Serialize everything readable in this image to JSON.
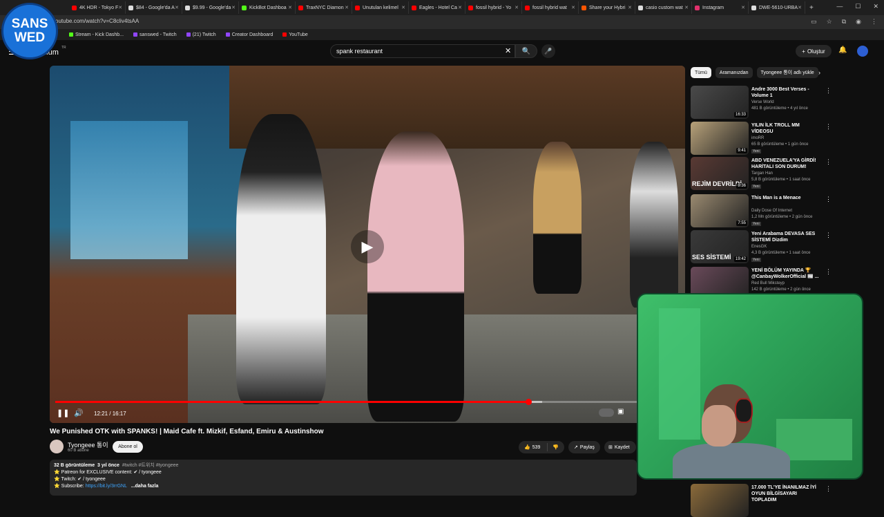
{
  "browser": {
    "tabs": [
      {
        "label": "4K HDR - Tokyo F",
        "color": "#ff0000"
      },
      {
        "label": "$84 - Google'da A",
        "color": "#dddddd"
      },
      {
        "label": "$9.99 - Google'da",
        "color": "#dddddd"
      },
      {
        "label": "KickBot Dashboa",
        "color": "#53fc18"
      },
      {
        "label": "TraxNYC Diamon",
        "color": "#ff0000"
      },
      {
        "label": "Unutulan kelimel",
        "color": "#ff0000"
      },
      {
        "label": "Eagles - Hotel Ca",
        "color": "#ff0000"
      },
      {
        "label": "fossil hybrid - Yo",
        "color": "#ff0000"
      },
      {
        "label": "fossil hybrid wat",
        "color": "#ff0000"
      },
      {
        "label": "Share your Hybri",
        "color": "#ff5500"
      },
      {
        "label": "casio custom wat",
        "color": "#dddddd"
      },
      {
        "label": "Instagram",
        "color": "#e1306c"
      },
      {
        "label": "DWE-5610-URBA",
        "color": "#dddddd"
      }
    ],
    "url": "outube.com/watch?v=C8cliv4tsAA",
    "bookmarks": [
      {
        "label": "Stream - Kick Dashb...",
        "color": "#53fc18"
      },
      {
        "label": "sanswed - Twitch",
        "color": "#9146ff"
      },
      {
        "label": "(21) Twitch",
        "color": "#9146ff"
      },
      {
        "label": "Creator Dashboard",
        "color": "#9146ff"
      },
      {
        "label": "YouTube",
        "color": "#ff0000"
      }
    ]
  },
  "overlay_logo": {
    "line1": "SANS",
    "line2": "WED"
  },
  "header": {
    "brand": "mium",
    "tm": "TR",
    "search_value": "spank restaurant",
    "create_label": "Oluştur"
  },
  "video": {
    "current_time": "12:21",
    "duration": "16:17",
    "time_display": "12:21 / 16:17",
    "progress_fraction": 0.758,
    "loaded_fraction": 0.78,
    "title": "We Punished OTK with SPANKS! | Maid Cafe ft. Mizkif, Esfand, Emiru & Austinshow",
    "channel": "Tyongeee 통이",
    "subscribers": "60 B abone",
    "subscribe_label": "Abone ol",
    "likes": "539",
    "share_label": "Paylaş",
    "save_label": "Kaydet"
  },
  "description": {
    "views": "32 B görüntüleme",
    "age": "3 yıl önce",
    "tags": "#twitch #트위치 #tyongeee",
    "line1": "⭐ Patreon for EXCLUSIVE content: ✔ / tyongeee",
    "line2": "⭐ Twitch: ✔ / tyongeee",
    "line3_prefix": "⭐ Subscribe: ",
    "line3_link": "https://bit.ly/3rrGNL",
    "more": "...daha fazla"
  },
  "chips": [
    "Tümü",
    "Aramanızdan",
    "Tyongeee 통이 adlı yükle"
  ],
  "recommendations": [
    {
      "title": "Andre 3000 Best Verses - Volume 1",
      "channel": "Verse World",
      "meta": "481 B görüntüleme • 4 yıl önce",
      "duration": "16:33",
      "badge": "",
      "thumb": "#4a4a4a",
      "word": ""
    },
    {
      "title": "YILIN İLK TROLL MM VİDEOSU",
      "channel": "imoRR",
      "meta": "65 B görüntüleme • 1 gün önce",
      "duration": "9:41",
      "badge": "Yeni",
      "thumb": "#b8a27a",
      "word": ""
    },
    {
      "title": "ABD VENEZUELA'YA GİRDİ! HARİTALI SON DURUM!",
      "channel": "Targan Han",
      "meta": "5,8 B görüntüleme • 1 saat önce",
      "duration": "9:36",
      "badge": "Yeni",
      "thumb": "#5a3a34",
      "word": "REJİM DEVRİLDİ"
    },
    {
      "title": "This Man is a Menace",
      "channel": "Daily Dose Of Internet",
      "meta": "1,2 Mn görüntüleme • 2 gün önce",
      "duration": "7:55",
      "badge": "Yeni",
      "thumb": "#9a8a70",
      "word": ""
    },
    {
      "title": "Yeni Arabama DEVASA SES SİSTEMİ Dizdim",
      "channel": "EnesGK",
      "meta": "4,3 B görüntüleme • 1 saat önce",
      "duration": "19:42",
      "badge": "Yeni",
      "thumb": "#3a3a3a",
      "word": "SES SİSTEMİ"
    },
    {
      "title": "YENİ BÖLÜM YAYINDA 🏆 @CanbayWolkerOfficial 📰 ...",
      "channel": "Red Bull Mikstеyp",
      "meta": "142 B görüntüleme • 2 gün önce",
      "duration": "",
      "badge": "",
      "thumb": "#6a4a5a",
      "word": ""
    },
    {
      "title": "17.000 TL'YE İNANILMAZ İYİ OYUN BİLGİSAYARI TOPLADIM",
      "channel": "",
      "meta": "",
      "duration": "",
      "badge": "",
      "thumb": "#8a6a3a",
      "word": ""
    }
  ],
  "icons": {
    "menu": "☰",
    "search": "🔍",
    "mic": "🎤",
    "bell": "🔔",
    "clear": "✕",
    "pause": "❚❚",
    "volume": "🔊",
    "play": "▶",
    "like": "👍",
    "dislike": "👎",
    "share": "↗",
    "save": "⊞",
    "more": "⋮",
    "next": "›",
    "plus": "+"
  }
}
